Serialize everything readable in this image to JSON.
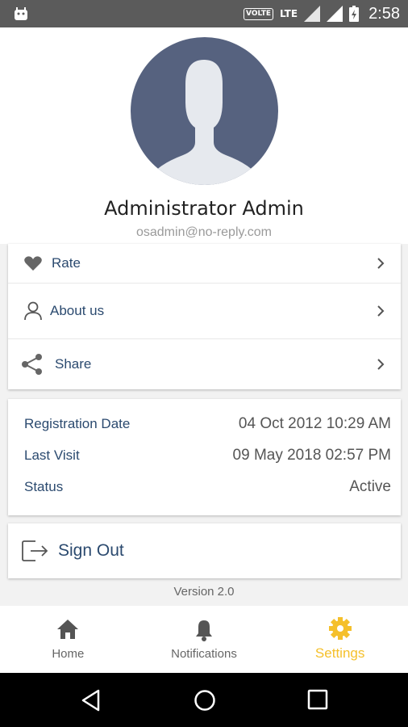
{
  "status_bar": {
    "volte": "VOLTE",
    "network": "LTE",
    "time": "2:58"
  },
  "profile": {
    "name": "Administrator Admin",
    "email": "osadmin@no-reply.com"
  },
  "menu": {
    "items": [
      {
        "label": "Rate",
        "icon": "heart-icon"
      },
      {
        "label": "About us",
        "icon": "user-icon"
      },
      {
        "label": "Share",
        "icon": "share-icon"
      }
    ]
  },
  "info": {
    "registration_label": "Registration Date",
    "registration_value": "04 Oct 2012 10:29 AM",
    "last_visit_label": "Last Visit",
    "last_visit_value": "09 May 2018 02:57 PM",
    "status_label": "Status",
    "status_value": "Active"
  },
  "sign_out": {
    "label": "Sign Out",
    "icon": "sign-out-icon"
  },
  "version": "Version 2.0",
  "bottom_nav": {
    "tabs": [
      {
        "label": "Home",
        "icon": "home-icon",
        "active": false
      },
      {
        "label": "Notifications",
        "icon": "bell-icon",
        "active": false
      },
      {
        "label": "Settings",
        "icon": "gear-icon",
        "active": true
      }
    ]
  },
  "colors": {
    "accent": "#f5c02b",
    "label_blue": "#2b4a6f",
    "avatar_bg": "#56627f"
  }
}
